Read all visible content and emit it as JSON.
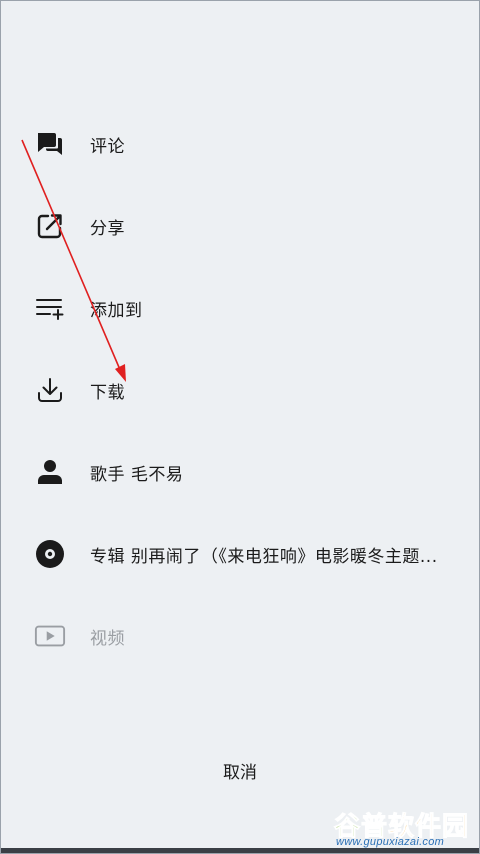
{
  "menu": {
    "items": [
      {
        "label": "评论",
        "icon": "comment-icon"
      },
      {
        "label": "分享",
        "icon": "share-icon"
      },
      {
        "label": "添加到",
        "icon": "add-to-playlist-icon"
      },
      {
        "label": "下载",
        "icon": "download-icon"
      },
      {
        "label": "歌手 毛不易",
        "icon": "artist-icon"
      },
      {
        "label": "专辑 别再闹了（《来电狂响》电影暖冬主题...",
        "icon": "album-disc-icon"
      },
      {
        "label": "视频",
        "icon": "video-icon",
        "disabled": true
      }
    ]
  },
  "cancel_label": "取消",
  "watermark": {
    "brand_1": "谷普",
    "brand_2": "软件园",
    "url": "www.gupuxiazai.com"
  },
  "colors": {
    "background": "#edf0f3",
    "text": "#1b1b1b",
    "disabled_text": "#9a9ea3",
    "annotation_arrow": "#e02020"
  }
}
